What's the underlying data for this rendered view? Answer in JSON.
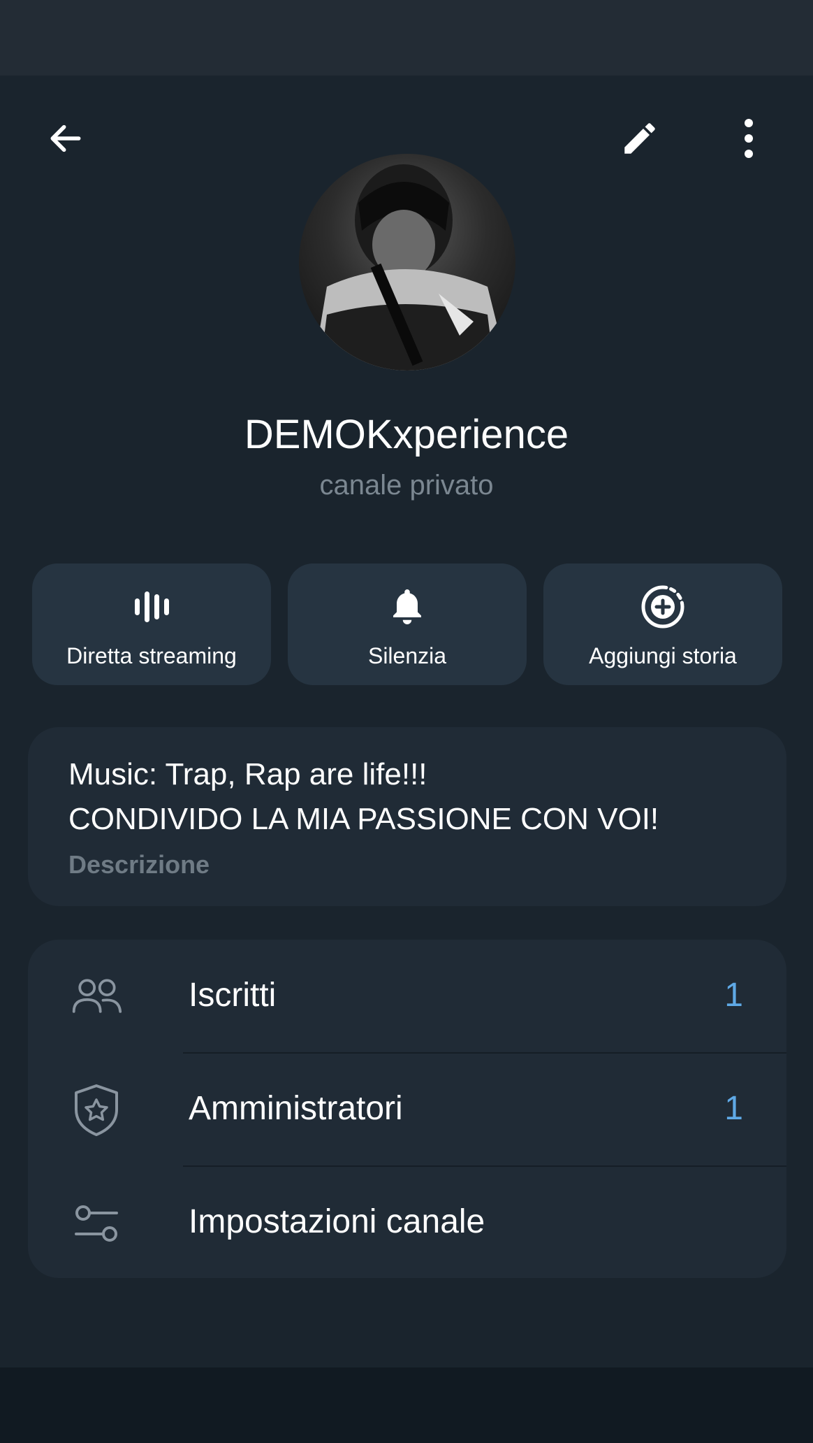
{
  "header": {
    "back_icon": "arrow-left-icon",
    "edit_icon": "pencil-icon",
    "more_icon": "more-vertical-icon"
  },
  "channel": {
    "name": "DEMOKxperience",
    "subtitle": "canale privato"
  },
  "actions": [
    {
      "label": "Diretta streaming",
      "icon": "live-stream-icon"
    },
    {
      "label": "Silenzia",
      "icon": "bell-icon"
    },
    {
      "label": "Aggiungi storia",
      "icon": "add-story-icon"
    }
  ],
  "description": {
    "text": "Music: Trap, Rap are life!!!\nCONDIVIDO LA MIA PASSIONE CON VOI!",
    "label": "Descrizione"
  },
  "list": [
    {
      "label": "Iscritti",
      "count": "1",
      "icon": "users-icon"
    },
    {
      "label": "Amministratori",
      "count": "1",
      "icon": "shield-star-icon"
    },
    {
      "label": "Impostazioni canale",
      "count": "",
      "icon": "settings-sliders-icon"
    }
  ],
  "colors": {
    "background": "#1a242d",
    "card": "#202b36",
    "action_button": "#263441",
    "accent": "#5fa9e6",
    "muted_text": "#7b8791"
  }
}
